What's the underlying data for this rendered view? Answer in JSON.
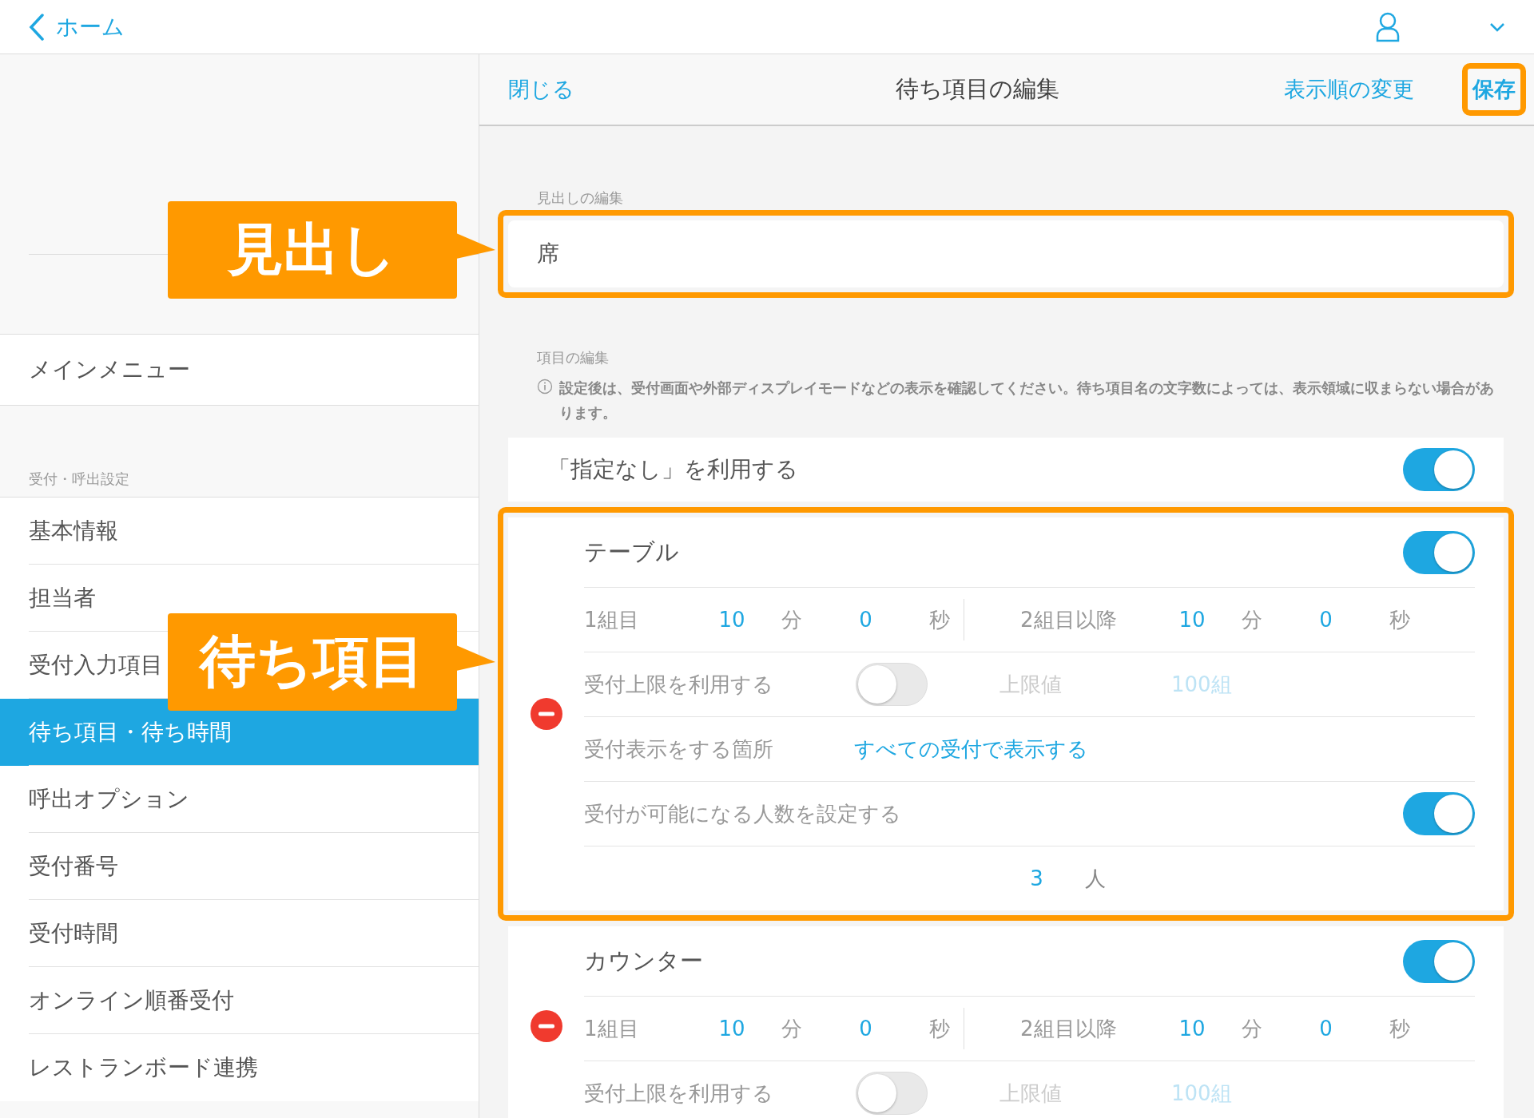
{
  "top_bar": {
    "back_label": "ホーム"
  },
  "sidebar": {
    "main_menu": "メインメニュー",
    "section_label": "受付・呼出設定",
    "items": [
      {
        "label": "基本情報",
        "selected": false
      },
      {
        "label": "担当者",
        "selected": false
      },
      {
        "label": "受付入力項目",
        "selected": false
      },
      {
        "label": "待ち項目・待ち時間",
        "selected": true
      },
      {
        "label": "呼出オプション",
        "selected": false
      },
      {
        "label": "受付番号",
        "selected": false
      },
      {
        "label": "受付時間",
        "selected": false
      },
      {
        "label": "オンライン順番受付",
        "selected": false
      },
      {
        "label": "レストランボード連携",
        "selected": false
      }
    ]
  },
  "panel": {
    "close": "閉じる",
    "title": "待ち項目の編集",
    "reorder": "表示順の変更",
    "save": {
      "label": "保存",
      "highlighted": true
    }
  },
  "heading_section": {
    "label": "見出しの編集",
    "value": "席",
    "highlighted": true
  },
  "items_section": {
    "label": "項目の編集",
    "note": "設定後は、受付画面や外部ディスプレイモードなどの表示を確認してください。待ち項目名の文字数によっては、表示領域に収まらない場合があります。",
    "unspecified": {
      "label": "「指定なし」を利用する",
      "on": true
    }
  },
  "wait_items": [
    {
      "name": "テーブル",
      "on": true,
      "highlighted": true,
      "first_group": {
        "label": "1組目",
        "minutes": "10",
        "minutes_unit": "分",
        "seconds": "0",
        "seconds_unit": "秒"
      },
      "later_groups": {
        "label": "2組目以降",
        "minutes": "10",
        "minutes_unit": "分",
        "seconds": "0",
        "seconds_unit": "秒"
      },
      "limit": {
        "label": "受付上限を利用する",
        "on": false,
        "value_label": "上限値",
        "value": "100組"
      },
      "display": {
        "label": "受付表示をする箇所",
        "value": "すべての受付で表示する"
      },
      "capacity": {
        "label": "受付が可能になる人数を設定する",
        "on": true,
        "value": "3",
        "unit": "人"
      }
    },
    {
      "name": "カウンター",
      "on": true,
      "highlighted": false,
      "first_group": {
        "label": "1組目",
        "minutes": "10",
        "minutes_unit": "分",
        "seconds": "0",
        "seconds_unit": "秒"
      },
      "later_groups": {
        "label": "2組目以降",
        "minutes": "10",
        "minutes_unit": "分",
        "seconds": "0",
        "seconds_unit": "秒"
      },
      "limit": {
        "label": "受付上限を利用する",
        "on": false,
        "value_label": "上限値",
        "value": "100組"
      }
    }
  ],
  "annotations": [
    {
      "text": "見出し"
    },
    {
      "text": "待ち項目"
    }
  ]
}
